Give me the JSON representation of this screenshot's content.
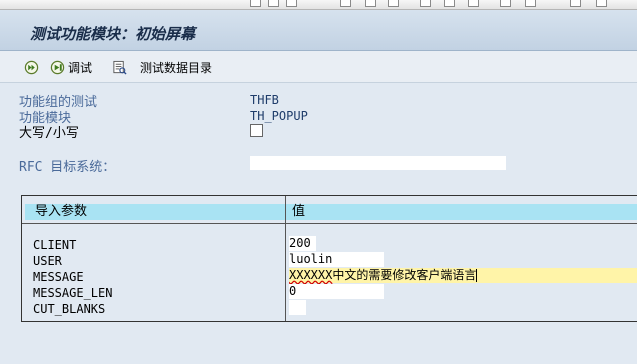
{
  "window": {
    "title": "测试功能模块：初始屏幕"
  },
  "toolbar": {
    "debug_label": "调试",
    "test_data_label": "测试数据目录"
  },
  "header_fields": {
    "function_group_label": "功能组的测试",
    "function_group_value": "THFB",
    "function_module_label": "功能模块",
    "function_module_value": "TH_POPUP",
    "case_label": "大写/小写",
    "case_checked": false,
    "rfc_label": "RFC 目标系统：",
    "rfc_value": ""
  },
  "params_table": {
    "col_param": "导入参数",
    "col_value": "值",
    "rows": [
      {
        "name": "CLIENT",
        "value": "200"
      },
      {
        "name": "USER",
        "value": "luolin"
      },
      {
        "name": "MESSAGE",
        "value_prefix": "XXXXXX",
        "value_rest": "中文的需要修改客户端语言"
      },
      {
        "name": "MESSAGE_LEN",
        "value": "0"
      },
      {
        "name": "CUT_BLANKS",
        "value": ""
      }
    ]
  }
}
